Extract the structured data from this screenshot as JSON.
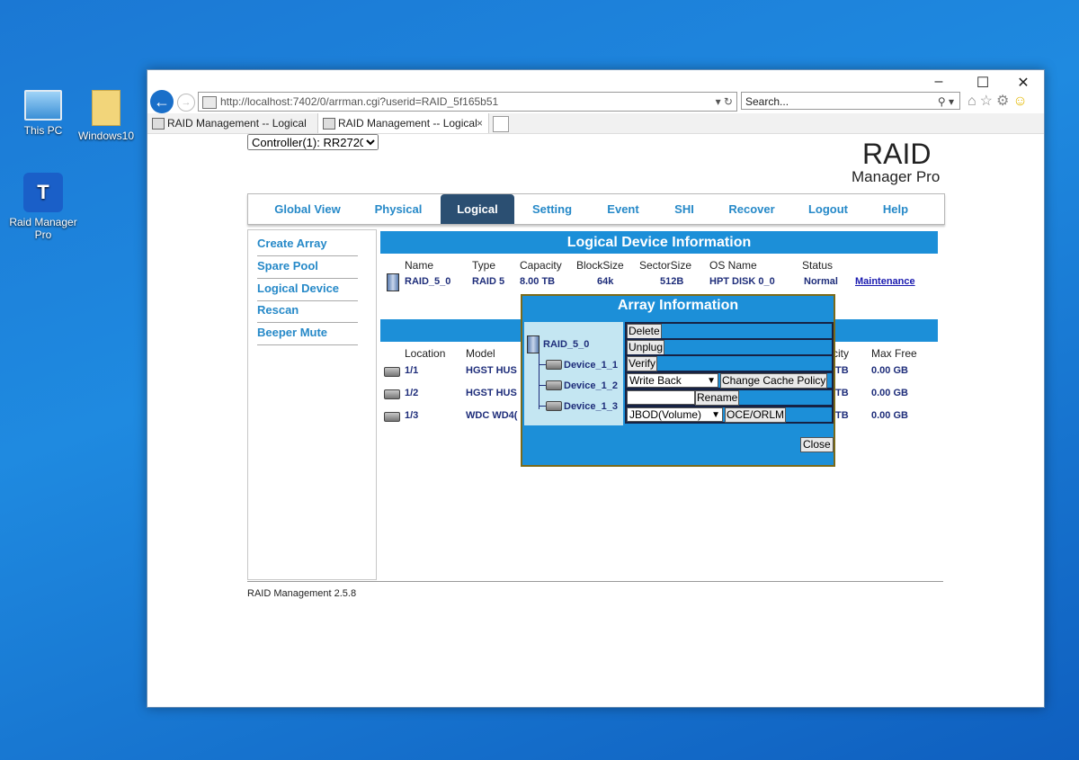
{
  "desktop": {
    "icons": [
      {
        "label": "This PC"
      },
      {
        "label": "Windows10"
      },
      {
        "label": "Raid Manager Pro"
      }
    ]
  },
  "browser": {
    "url": "http://localhost:7402/0/arrman.cgi?userid=RAID_5f165b51",
    "search_placeholder": "Search...",
    "tabs": [
      {
        "label": "RAID Management -- Logical"
      },
      {
        "label": "RAID Management -- Logical"
      }
    ]
  },
  "page": {
    "controller_select": "Controller(1): RR2720",
    "logo_line1": "RAID",
    "logo_line2": "Manager Pro",
    "nav": [
      "Global View",
      "Physical",
      "Logical",
      "Setting",
      "Event",
      "SHI",
      "Recover",
      "Logout",
      "Help"
    ],
    "nav_active": "Logical",
    "sidebar": [
      "Create Array",
      "Spare Pool",
      "Logical Device",
      "Rescan",
      "Beeper Mute"
    ],
    "logical_section_title": "Logical Device Information",
    "logical_headers": [
      "Name",
      "Type",
      "Capacity",
      "BlockSize",
      "SectorSize",
      "OS Name",
      "Status"
    ],
    "logical_row": {
      "name": "RAID_5_0",
      "type": "RAID 5",
      "capacity": "8.00 TB",
      "blocksize": "64k",
      "sectorsize": "512B",
      "os_name": "HPT DISK 0_0",
      "status": "Normal",
      "action": "Maintenance"
    },
    "device_headers": [
      "Location",
      "Model",
      "city",
      "Max Free"
    ],
    "devices": [
      {
        "location": "1/1",
        "model": "HGST HUS",
        "capacity": "TB",
        "max_free": "0.00 GB"
      },
      {
        "location": "1/2",
        "model": "HGST HUS",
        "capacity": "TB",
        "max_free": "0.00 GB"
      },
      {
        "location": "1/3",
        "model": "WDC WD4(",
        "capacity": "TB",
        "max_free": "0.00 GB"
      }
    ],
    "footer": "RAID Management 2.5.8"
  },
  "dialog": {
    "title": "Array Information",
    "array_name": "RAID_5_0",
    "members": [
      "Device_1_1",
      "Device_1_2",
      "Device_1_3"
    ],
    "delete": "Delete",
    "unplug": "Unplug",
    "verify": "Verify",
    "cache_policy_value": "Write Back",
    "change_cache_policy": "Change Cache Policy",
    "rename_value": "",
    "rename": "Rename",
    "oce_value": "JBOD(Volume)",
    "oce_orlm": "OCE/ORLM",
    "close": "Close"
  },
  "colors": {
    "accent": "#1c8fd8",
    "nav_active_bg": "#2b4f72",
    "link": "#2689c8"
  }
}
